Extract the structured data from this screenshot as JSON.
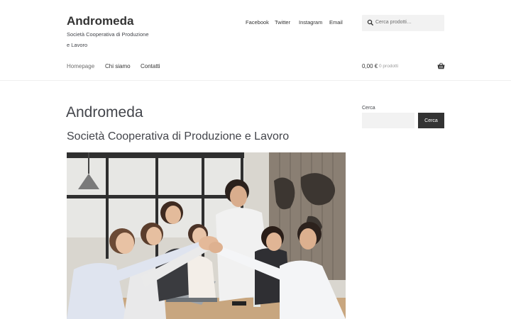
{
  "site": {
    "title": "Andromeda",
    "tagline": "Società Cooperativa di Produzione e Lavoro"
  },
  "social": [
    "Facebook",
    "Twitter",
    "Instagram",
    "Email"
  ],
  "search_top": {
    "placeholder": "Cerca prodotti…"
  },
  "nav": [
    "Homepage",
    "Chi siamo",
    "Contatti"
  ],
  "cart": {
    "total": "0,00 €",
    "count": "0 prodotti"
  },
  "main": {
    "title": "Andromeda",
    "subtitle": "Società Cooperativa di Produzione e Lavoro"
  },
  "widget": {
    "label": "Cerca",
    "button": "Cerca"
  },
  "colors": {
    "text": "#43454b",
    "heading": "#333333",
    "button_bg": "#333333",
    "input_bg": "#f2f2f2"
  }
}
